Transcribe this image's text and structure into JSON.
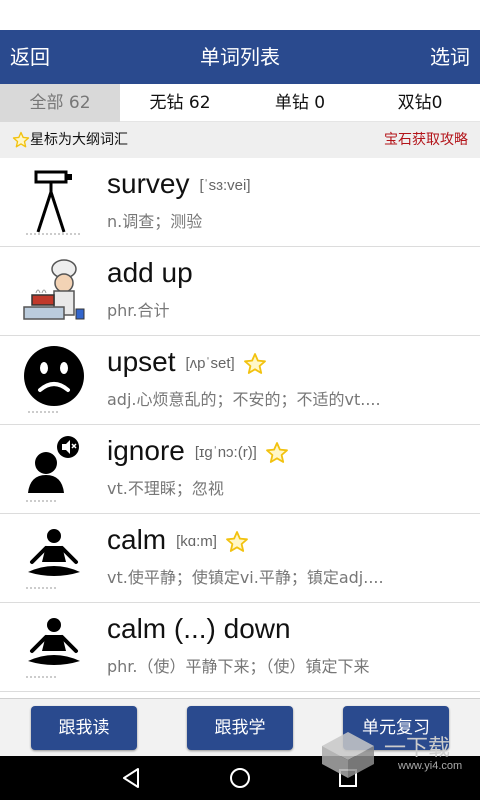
{
  "header": {
    "back_label": "返回",
    "title": "单词列表",
    "select_label": "选词"
  },
  "tabs": [
    {
      "label": "全部 62",
      "active": true
    },
    {
      "label": "无钻 62",
      "active": false
    },
    {
      "label": "单钻 0",
      "active": false
    },
    {
      "label": "双钻0",
      "active": false
    }
  ],
  "info": {
    "note": "星标为大纲词汇",
    "guide_link": "宝石获取攻略"
  },
  "words": [
    {
      "word": "survey",
      "phonetic": "[ˈsɜ:vei]",
      "definition": "n.调查；测验",
      "starred": false,
      "icon": "survey-tripod-icon"
    },
    {
      "word": "add up",
      "phonetic": "",
      "definition": "phr.合计",
      "starred": false,
      "icon": "chef-cooking-icon"
    },
    {
      "word": "upset",
      "phonetic": "[ʌpˈset]",
      "definition": "adj.心烦意乱的；不安的；不适的vt....",
      "starred": true,
      "icon": "sad-face-icon"
    },
    {
      "word": "ignore",
      "phonetic": "[ɪgˈnɔ:(r)]",
      "definition": "vt.不理睬；忽视",
      "starred": true,
      "icon": "muted-person-icon"
    },
    {
      "word": "calm",
      "phonetic": "[kɑ:m]",
      "definition": "vt.使平静；使镇定vi.平静；镇定adj....",
      "starred": true,
      "icon": "meditation-icon"
    },
    {
      "word": "calm (...) down",
      "phonetic": "",
      "definition": "phr.（使）平静下来；（使）镇定下来",
      "starred": false,
      "icon": "meditation-icon"
    }
  ],
  "bottom_buttons": {
    "read_along": "跟我读",
    "learn_along": "跟我学",
    "unit_review": "单元复习"
  },
  "watermark": {
    "text": "一下载",
    "url": "www.yi4.com"
  },
  "colors": {
    "header_bg": "#2a4a8e",
    "guide_link": "#b3141a",
    "star": "#f2c20f"
  }
}
